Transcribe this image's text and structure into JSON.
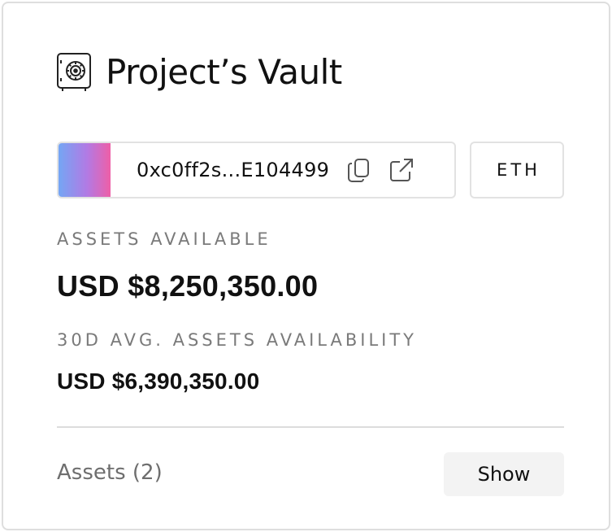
{
  "vault": {
    "title": "Project’s Vault",
    "icon": "vault-safe-icon"
  },
  "wallet": {
    "address": "0xc0ff2s...E104499",
    "swatch_gradient": [
      "#74a6f4",
      "#b27ae4",
      "#ee5fa7"
    ],
    "copy_icon": "copy-icon",
    "open_icon": "external-link-icon",
    "network": "ETH"
  },
  "assets_available": {
    "label": "ASSETS AVAILABLE",
    "value": "USD $8,250,350.00"
  },
  "avg_availability": {
    "label": "30D AVG. ASSETS AVAILABILITY",
    "value": "USD $6,390,350.00"
  },
  "assets_list": {
    "label": "Assets (2)",
    "show_label": "Show"
  },
  "colors": {
    "border": "#dedede",
    "muted_text": "#7a7a7a",
    "button_bg": "#f3f3f3"
  }
}
